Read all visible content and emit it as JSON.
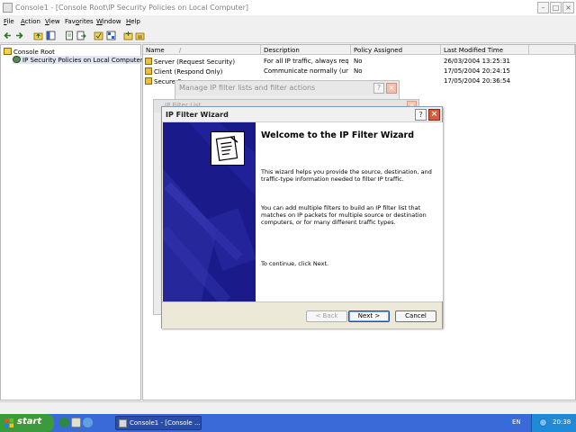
{
  "window": {
    "title": "Console1 - [Console Root\\IP Security Policies on Local Computer]",
    "minimize_glyph": "–",
    "maximize_glyph": "□",
    "close_glyph": "×"
  },
  "menu": [
    {
      "label": "File",
      "key": "F"
    },
    {
      "label": "Action",
      "key": "A"
    },
    {
      "label": "View",
      "key": "V"
    },
    {
      "label": "Favorites",
      "key": "o"
    },
    {
      "label": "Window",
      "key": "W"
    },
    {
      "label": "Help",
      "key": "H"
    }
  ],
  "toolbar": {
    "icons": [
      "back-icon",
      "forward-icon",
      "up-icon",
      "show-hide-tree-icon",
      "new-window-icon",
      "export-list-icon",
      "properties-icon",
      "help-icon",
      "create-policy-icon",
      "manage-filters-icon"
    ]
  },
  "tree": {
    "root_label": "Console Root",
    "child_label": "IP Security Policies on Local Computer"
  },
  "list": {
    "columns": [
      "Name",
      "Description",
      "Policy Assigned",
      "Last Modified Time"
    ],
    "sort_glyph": "/",
    "rows": [
      {
        "name": "Server (Request Security)",
        "description": "For all IP traffic, always req...",
        "assigned": "No",
        "modified": "26/03/2004 13:25:31"
      },
      {
        "name": "Client (Respond Only)",
        "description": "Communicate normally (uns...",
        "assigned": "No",
        "modified": "17/05/2004 20:24:15"
      },
      {
        "name": "Secure S...",
        "description": "",
        "assigned": "",
        "modified": "17/05/2004 20:36:54"
      }
    ]
  },
  "dialogs": {
    "manage": {
      "title": "Manage IP filter lists and filter actions"
    },
    "list": {
      "title": "IP Filter List"
    }
  },
  "wizard": {
    "title": "IP Filter Wizard",
    "help_glyph": "?",
    "close_glyph": "×",
    "heading": "Welcome to the IP Filter Wizard",
    "para1": "This wizard helps you provide the source, destination, and traffic-type information needed to filter IP traffic.",
    "para2": "You can add multiple filters to build an IP filter list that matches on IP packets for multiple source or destination computers, or for many different traffic types.",
    "para3": "To continue, click Next.",
    "back_label": "< Back",
    "next_label": "Next >",
    "cancel_label": "Cancel"
  },
  "taskbar": {
    "start_label": "start",
    "task_label": "Console1 - [Console ...",
    "language": "EN",
    "clock": "20:38"
  },
  "colors": {
    "wizard_banner": "#1a1a8a",
    "taskbar": "#3a6ad8",
    "start_button": "#3b9a3b",
    "tray": "#1e8ad8"
  }
}
